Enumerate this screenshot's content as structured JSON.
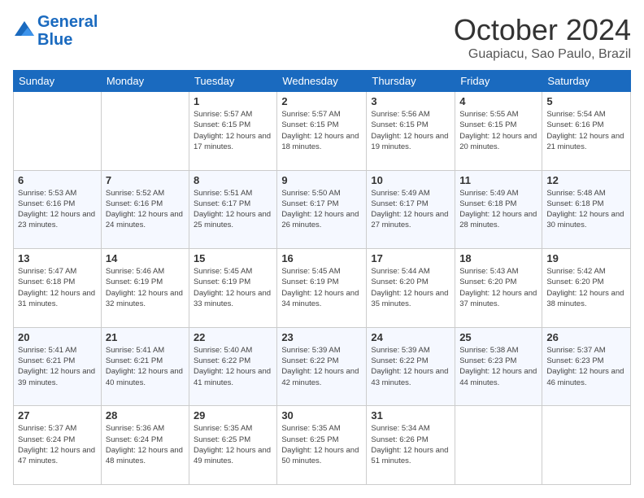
{
  "header": {
    "logo_line1": "General",
    "logo_line2": "Blue",
    "month": "October 2024",
    "location": "Guapiacu, Sao Paulo, Brazil"
  },
  "days_of_week": [
    "Sunday",
    "Monday",
    "Tuesday",
    "Wednesday",
    "Thursday",
    "Friday",
    "Saturday"
  ],
  "weeks": [
    [
      {
        "num": "",
        "info": ""
      },
      {
        "num": "",
        "info": ""
      },
      {
        "num": "1",
        "info": "Sunrise: 5:57 AM\nSunset: 6:15 PM\nDaylight: 12 hours and 17 minutes."
      },
      {
        "num": "2",
        "info": "Sunrise: 5:57 AM\nSunset: 6:15 PM\nDaylight: 12 hours and 18 minutes."
      },
      {
        "num": "3",
        "info": "Sunrise: 5:56 AM\nSunset: 6:15 PM\nDaylight: 12 hours and 19 minutes."
      },
      {
        "num": "4",
        "info": "Sunrise: 5:55 AM\nSunset: 6:15 PM\nDaylight: 12 hours and 20 minutes."
      },
      {
        "num": "5",
        "info": "Sunrise: 5:54 AM\nSunset: 6:16 PM\nDaylight: 12 hours and 21 minutes."
      }
    ],
    [
      {
        "num": "6",
        "info": "Sunrise: 5:53 AM\nSunset: 6:16 PM\nDaylight: 12 hours and 23 minutes."
      },
      {
        "num": "7",
        "info": "Sunrise: 5:52 AM\nSunset: 6:16 PM\nDaylight: 12 hours and 24 minutes."
      },
      {
        "num": "8",
        "info": "Sunrise: 5:51 AM\nSunset: 6:17 PM\nDaylight: 12 hours and 25 minutes."
      },
      {
        "num": "9",
        "info": "Sunrise: 5:50 AM\nSunset: 6:17 PM\nDaylight: 12 hours and 26 minutes."
      },
      {
        "num": "10",
        "info": "Sunrise: 5:49 AM\nSunset: 6:17 PM\nDaylight: 12 hours and 27 minutes."
      },
      {
        "num": "11",
        "info": "Sunrise: 5:49 AM\nSunset: 6:18 PM\nDaylight: 12 hours and 28 minutes."
      },
      {
        "num": "12",
        "info": "Sunrise: 5:48 AM\nSunset: 6:18 PM\nDaylight: 12 hours and 30 minutes."
      }
    ],
    [
      {
        "num": "13",
        "info": "Sunrise: 5:47 AM\nSunset: 6:18 PM\nDaylight: 12 hours and 31 minutes."
      },
      {
        "num": "14",
        "info": "Sunrise: 5:46 AM\nSunset: 6:19 PM\nDaylight: 12 hours and 32 minutes."
      },
      {
        "num": "15",
        "info": "Sunrise: 5:45 AM\nSunset: 6:19 PM\nDaylight: 12 hours and 33 minutes."
      },
      {
        "num": "16",
        "info": "Sunrise: 5:45 AM\nSunset: 6:19 PM\nDaylight: 12 hours and 34 minutes."
      },
      {
        "num": "17",
        "info": "Sunrise: 5:44 AM\nSunset: 6:20 PM\nDaylight: 12 hours and 35 minutes."
      },
      {
        "num": "18",
        "info": "Sunrise: 5:43 AM\nSunset: 6:20 PM\nDaylight: 12 hours and 37 minutes."
      },
      {
        "num": "19",
        "info": "Sunrise: 5:42 AM\nSunset: 6:20 PM\nDaylight: 12 hours and 38 minutes."
      }
    ],
    [
      {
        "num": "20",
        "info": "Sunrise: 5:41 AM\nSunset: 6:21 PM\nDaylight: 12 hours and 39 minutes."
      },
      {
        "num": "21",
        "info": "Sunrise: 5:41 AM\nSunset: 6:21 PM\nDaylight: 12 hours and 40 minutes."
      },
      {
        "num": "22",
        "info": "Sunrise: 5:40 AM\nSunset: 6:22 PM\nDaylight: 12 hours and 41 minutes."
      },
      {
        "num": "23",
        "info": "Sunrise: 5:39 AM\nSunset: 6:22 PM\nDaylight: 12 hours and 42 minutes."
      },
      {
        "num": "24",
        "info": "Sunrise: 5:39 AM\nSunset: 6:22 PM\nDaylight: 12 hours and 43 minutes."
      },
      {
        "num": "25",
        "info": "Sunrise: 5:38 AM\nSunset: 6:23 PM\nDaylight: 12 hours and 44 minutes."
      },
      {
        "num": "26",
        "info": "Sunrise: 5:37 AM\nSunset: 6:23 PM\nDaylight: 12 hours and 46 minutes."
      }
    ],
    [
      {
        "num": "27",
        "info": "Sunrise: 5:37 AM\nSunset: 6:24 PM\nDaylight: 12 hours and 47 minutes."
      },
      {
        "num": "28",
        "info": "Sunrise: 5:36 AM\nSunset: 6:24 PM\nDaylight: 12 hours and 48 minutes."
      },
      {
        "num": "29",
        "info": "Sunrise: 5:35 AM\nSunset: 6:25 PM\nDaylight: 12 hours and 49 minutes."
      },
      {
        "num": "30",
        "info": "Sunrise: 5:35 AM\nSunset: 6:25 PM\nDaylight: 12 hours and 50 minutes."
      },
      {
        "num": "31",
        "info": "Sunrise: 5:34 AM\nSunset: 6:26 PM\nDaylight: 12 hours and 51 minutes."
      },
      {
        "num": "",
        "info": ""
      },
      {
        "num": "",
        "info": ""
      }
    ]
  ]
}
